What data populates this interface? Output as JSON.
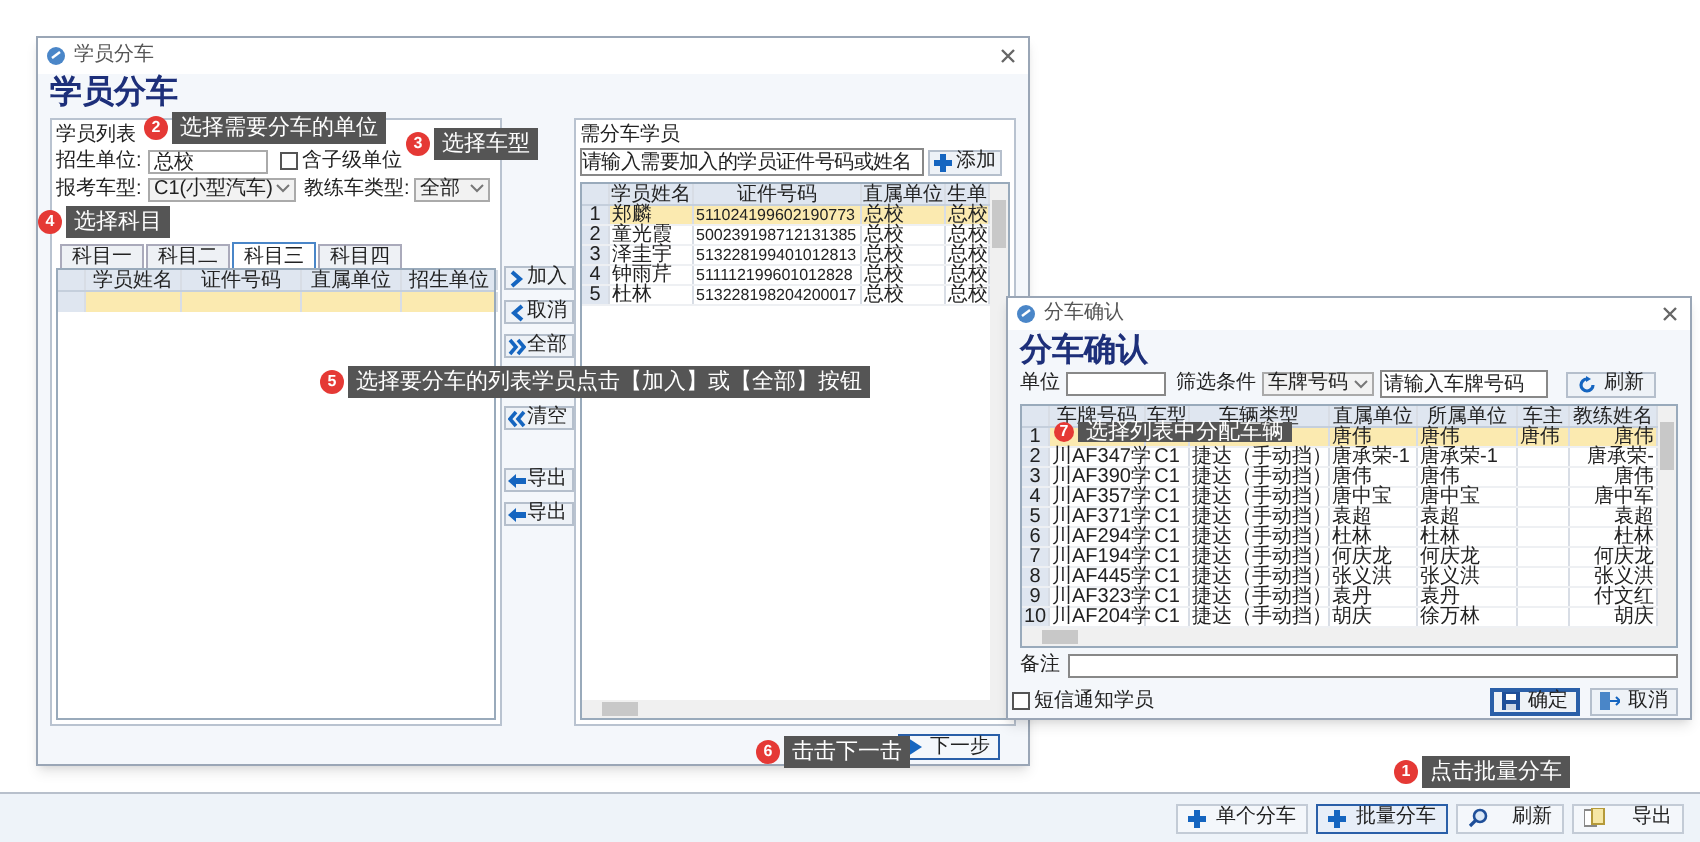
{
  "main_window": {
    "title": "学员分车",
    "heading": "学员分车",
    "student_list": {
      "group_title": "学员列表",
      "unit_label": "招生单位:",
      "unit_value": "总校",
      "include_sub": {
        "label": "含子级单位",
        "checked": false
      },
      "car_model_label": "报考车型:",
      "car_model_value": "C1(小型汽车)",
      "coach_car_label": "教练车类型:",
      "coach_car_value": "全部",
      "tabs": [
        {
          "label": "科目一",
          "selected": false
        },
        {
          "label": "科目二",
          "selected": false
        },
        {
          "label": "科目三",
          "selected": true
        },
        {
          "label": "科目四",
          "selected": false
        }
      ],
      "columns": [
        "学员姓名",
        "证件号码",
        "直属单位",
        "招生单位"
      ],
      "rows": [
        {
          "selected": true
        }
      ]
    },
    "transfer_buttons": [
      "加入",
      "取消",
      "全部",
      "清空",
      "导出",
      "导出"
    ],
    "assign_list": {
      "group_title": "需分车学员",
      "search_placeholder": "请输入需要加入的学员证件号码或姓名",
      "add_button": "添加",
      "columns": [
        "学员姓名",
        "证件号码",
        "直属单位",
        "生单"
      ],
      "rows": [
        {
          "number": "1",
          "cells": [
            "郑麟",
            "511024199602190773",
            "总校",
            "总校"
          ],
          "selected": true
        },
        {
          "number": "2",
          "cells": [
            "童光霞",
            "500239198712131385",
            "总校",
            "总校"
          ],
          "selected": false
        },
        {
          "number": "3",
          "cells": [
            "泽圭宇",
            "513228199401012813",
            "总校",
            "总校"
          ],
          "selected": false
        },
        {
          "number": "4",
          "cells": [
            "钟雨芹",
            "511112199601012828",
            "总校",
            "总校"
          ],
          "selected": false
        },
        {
          "number": "5",
          "cells": [
            "杜林",
            "513228198204200017",
            "总校",
            "总校"
          ],
          "selected": false
        }
      ]
    },
    "next_button": "下一步"
  },
  "confirm_window": {
    "title": "分车确认",
    "heading": "分车确认",
    "unit_label": "单位",
    "filter_label": "筛选条件",
    "filter_value": "车牌号码",
    "plate_placeholder": "请输入车牌号码",
    "refresh_button": "刷新",
    "columns": [
      "车牌号码",
      "车型",
      "车辆类型",
      "直属单位",
      "所属单位",
      "车主",
      "教练姓名"
    ],
    "rows": [
      {
        "number": "1",
        "direct_unit": "唐伟",
        "unit": "唐伟",
        "owner": "唐伟",
        "coach": "唐伟",
        "selected": true
      },
      {
        "number": "2",
        "plate": "川AF347学",
        "model": "C1",
        "vehicle": "捷达（手动挡）",
        "direct_unit": "唐承荣-1",
        "unit": "唐承荣-1",
        "coach": "唐承荣-",
        "selected": false
      },
      {
        "number": "3",
        "plate": "川AF390学",
        "model": "C1",
        "vehicle": "捷达（手动挡）",
        "direct_unit": "唐伟",
        "unit": "唐伟",
        "coach": "唐伟",
        "selected": false
      },
      {
        "number": "4",
        "plate": "川AF357学",
        "model": "C1",
        "vehicle": "捷达（手动挡）",
        "direct_unit": "唐中宝",
        "unit": "唐中宝",
        "coach": "唐中军",
        "selected": false
      },
      {
        "number": "5",
        "plate": "川AF371学",
        "model": "C1",
        "vehicle": "捷达（手动挡）",
        "direct_unit": "袁超",
        "unit": "袁超",
        "coach": "袁超",
        "selected": false
      },
      {
        "number": "6",
        "plate": "川AF294学",
        "model": "C1",
        "vehicle": "捷达（手动挡）",
        "direct_unit": "杜林",
        "unit": "杜林",
        "coach": "杜林",
        "selected": false
      },
      {
        "number": "7",
        "plate": "川AF194学",
        "model": "C1",
        "vehicle": "捷达（手动挡）",
        "direct_unit": "何庆龙",
        "unit": "何庆龙",
        "coach": "何庆龙",
        "selected": false
      },
      {
        "number": "8",
        "plate": "川AF445学",
        "model": "C1",
        "vehicle": "捷达（手动挡）",
        "direct_unit": "张义洪",
        "unit": "张义洪",
        "coach": "张义洪",
        "selected": false
      },
      {
        "number": "9",
        "plate": "川AF323学",
        "model": "C1",
        "vehicle": "捷达（手动挡）",
        "direct_unit": "袁丹",
        "unit": "袁丹",
        "coach": "付文红",
        "selected": false
      },
      {
        "number": "10",
        "plate": "川AF204学",
        "model": "C1",
        "vehicle": "捷达（手动挡）",
        "direct_unit": "胡庆",
        "unit": "徐万林",
        "coach": "胡庆",
        "selected": false
      }
    ],
    "remark_label": "备注",
    "sms_notify": {
      "label": "短信通知学员",
      "checked": false
    },
    "ok_button": "确定",
    "cancel_button": "取消"
  },
  "toolbar": [
    "单个分车",
    "批量分车",
    "刷新",
    "导出"
  ],
  "callouts": [
    {
      "number": "1",
      "text": "点击批量分车"
    },
    {
      "number": "2",
      "text": "选择需要分车的单位"
    },
    {
      "number": "3",
      "text": "选择车型"
    },
    {
      "number": "4",
      "text": "选择科目"
    },
    {
      "number": "5",
      "text": "选择要分车的列表学员点击【加入】或【全部】按钮"
    },
    {
      "number": "6",
      "text": "击击下一击"
    },
    {
      "number": "7",
      "text": "选择列表中分配车辆"
    }
  ]
}
